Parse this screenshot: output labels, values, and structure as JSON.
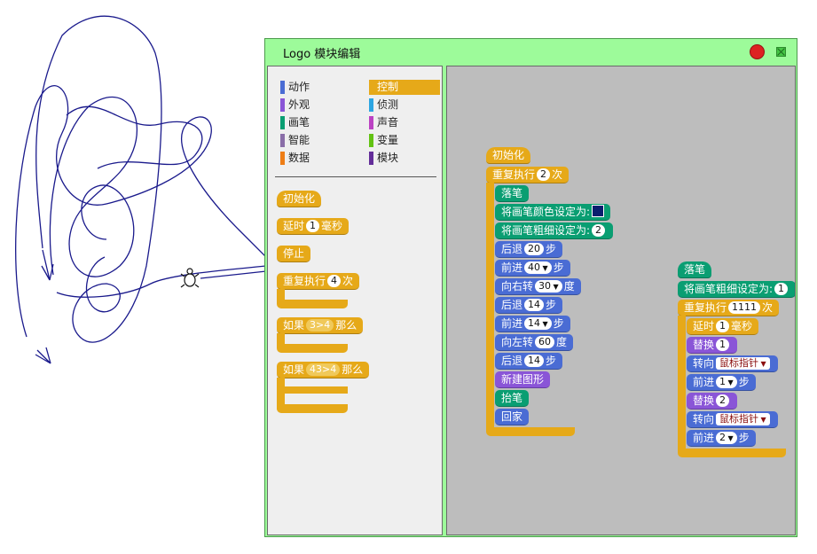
{
  "window": {
    "title": "Logo 模块编辑"
  },
  "palette": {
    "categories": [
      {
        "label": "动作",
        "color": "#4a6cd4"
      },
      {
        "label": "控制",
        "color": "#e6a919",
        "selected": true
      },
      {
        "label": "外观",
        "color": "#8a55d7"
      },
      {
        "label": "侦测",
        "color": "#2ca5e2"
      },
      {
        "label": "画笔",
        "color": "#0a9e72"
      },
      {
        "label": "声音",
        "color": "#bb42c3"
      },
      {
        "label": "智能",
        "color": "#8a6ea8"
      },
      {
        "label": "变量",
        "color": "#62c213"
      },
      {
        "label": "数据",
        "color": "#ee7d16"
      },
      {
        "label": "模块",
        "color": "#632d99"
      }
    ],
    "blocks": {
      "init": "初始化",
      "delay_label": "延时",
      "delay_value": "1",
      "delay_unit": "毫秒",
      "stop": "停止",
      "repeat_label": "重复执行",
      "repeat_value": "4",
      "repeat_unit": "次",
      "if_label": "如果",
      "if_cond": "3>4",
      "if_then": "那么",
      "ifelse_label": "如果",
      "ifelse_cond": "43>4",
      "ifelse_then": "那么"
    }
  },
  "script1": {
    "init": "初始化",
    "repeat_label": "重复执行",
    "repeat_value": "2",
    "repeat_unit": "次",
    "pen_down": "落笔",
    "set_color": "将画笔颜色设定为:",
    "set_width": "将画笔粗细设定为:",
    "set_width_value": "2",
    "back1_label": "后退",
    "back1_value": "20",
    "step": "步",
    "fwd1_label": "前进",
    "fwd1_value": "40",
    "turn_right_label": "向右转",
    "turn_right_value": "30",
    "degree": "度",
    "back2_label": "后退",
    "back2_value": "14",
    "fwd2_label": "前进",
    "fwd2_value": "14",
    "turn_left_label": "向左转",
    "turn_left_value": "60",
    "back3_label": "后退",
    "back3_value": "14",
    "new_shape": "新建图形",
    "pen_up": "抬笔",
    "home": "回家"
  },
  "script2": {
    "pen_down": "落笔",
    "set_width": "将画笔粗细设定为:",
    "set_width_value": "1",
    "repeat_label": "重复执行",
    "repeat_value": "1111",
    "repeat_unit": "次",
    "delay_label": "延时",
    "delay_value": "1",
    "delay_unit": "毫秒",
    "swap1_label": "替换",
    "swap1_value": "1",
    "point1_label": "转向",
    "point1_target": "鼠标指针",
    "fwd1_label": "前进",
    "fwd1_value": "1",
    "step": "步",
    "swap2_label": "替换",
    "swap2_value": "2",
    "point2_label": "转向",
    "point2_target": "鼠标指针",
    "fwd2_label": "前进",
    "fwd2_value": "2"
  },
  "colors": {
    "window_bg": "#9dfb9a",
    "script_bg": "#bdbdbd",
    "pen_color": "#0a1e6e",
    "drawing_stroke": "#1a1a8c"
  }
}
